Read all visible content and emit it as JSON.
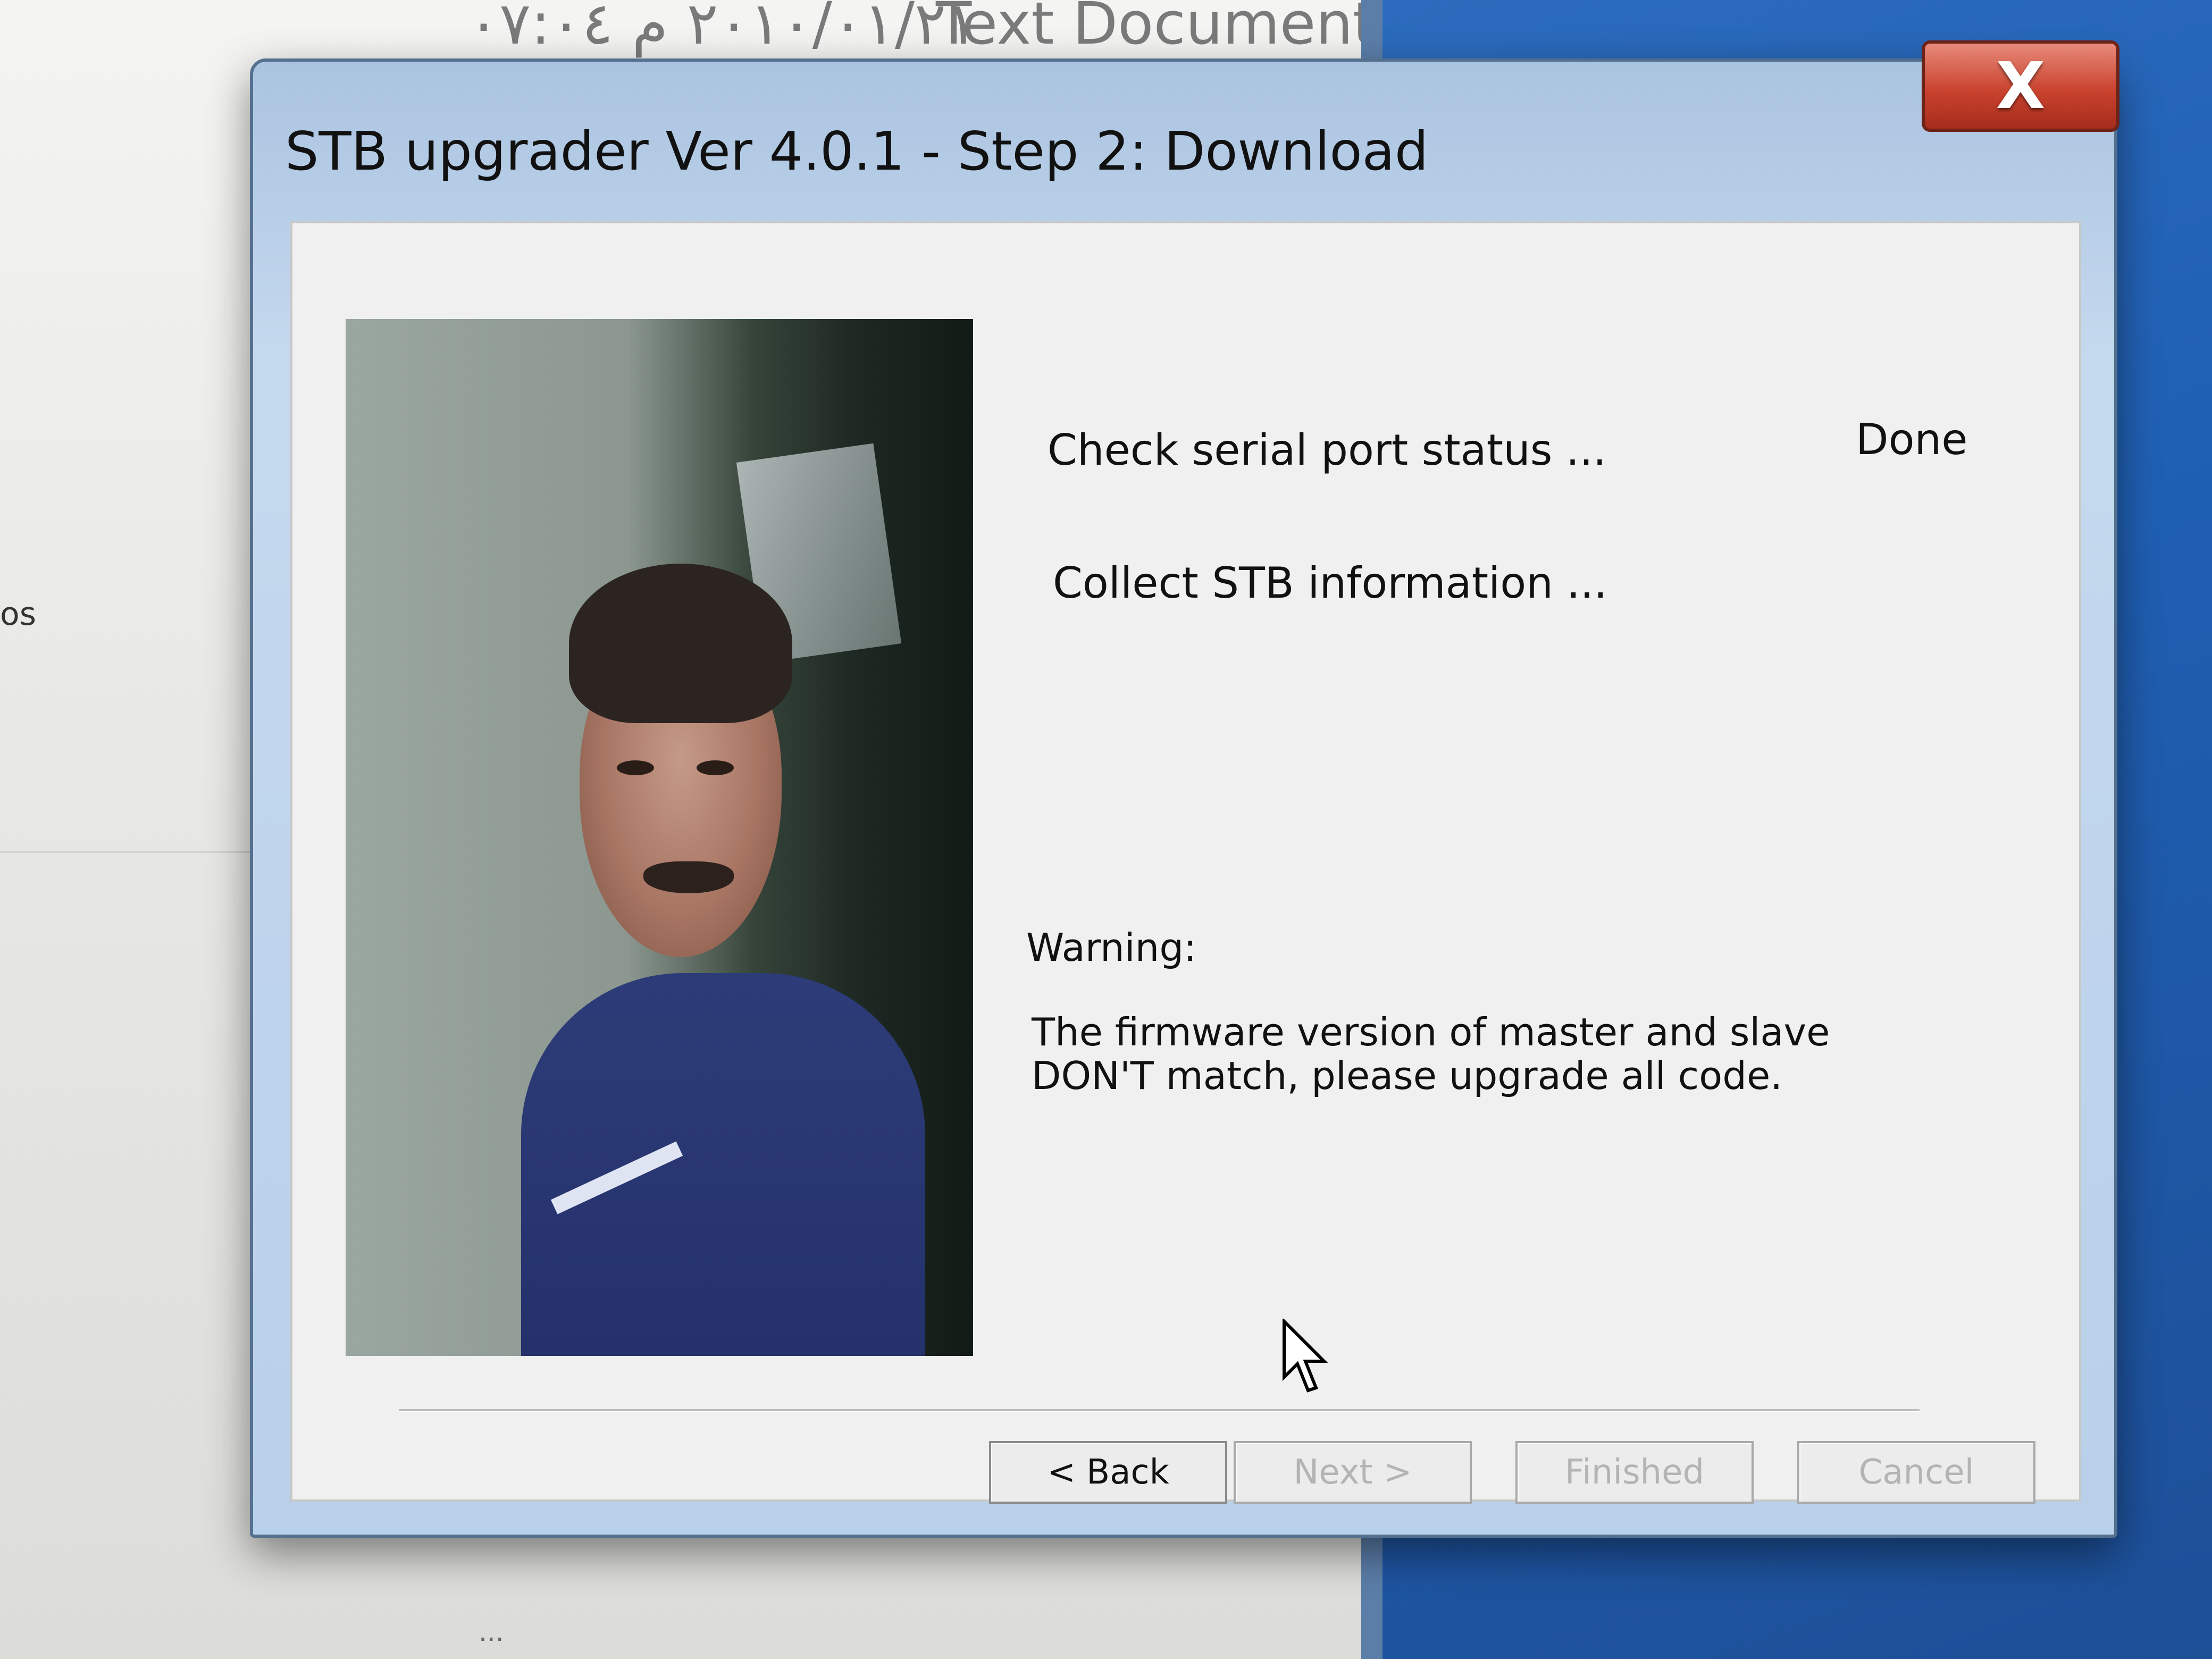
{
  "background": {
    "header_date_text": "٢٠١٠/٠١/٢١ م ٠٧:٠٤",
    "header_doc_text": "Text Document",
    "side_text": "os",
    "bottom_text": "..."
  },
  "dialog": {
    "title": "STB upgrader Ver 4.0.1 - Step 2: Download",
    "close_label": "X",
    "status": [
      {
        "label": "Check serial port status ...",
        "result": "Done"
      },
      {
        "label": "Collect STB information ...",
        "result": ""
      }
    ],
    "warning": {
      "heading": "Warning:",
      "message": "The firmware version of master and slave DON'T match, please upgrade all code."
    },
    "buttons": {
      "back": "< Back",
      "next": "Next >",
      "finished": "Finished",
      "cancel": "Cancel"
    }
  },
  "colors": {
    "title_bar": "#b9d0ea",
    "close_button": "#c9432f",
    "client_bg": "#f0f0f0",
    "desktop": "#1f5fb3"
  },
  "icons": {
    "close": "close-icon",
    "cursor": "mouse-pointer-icon"
  }
}
